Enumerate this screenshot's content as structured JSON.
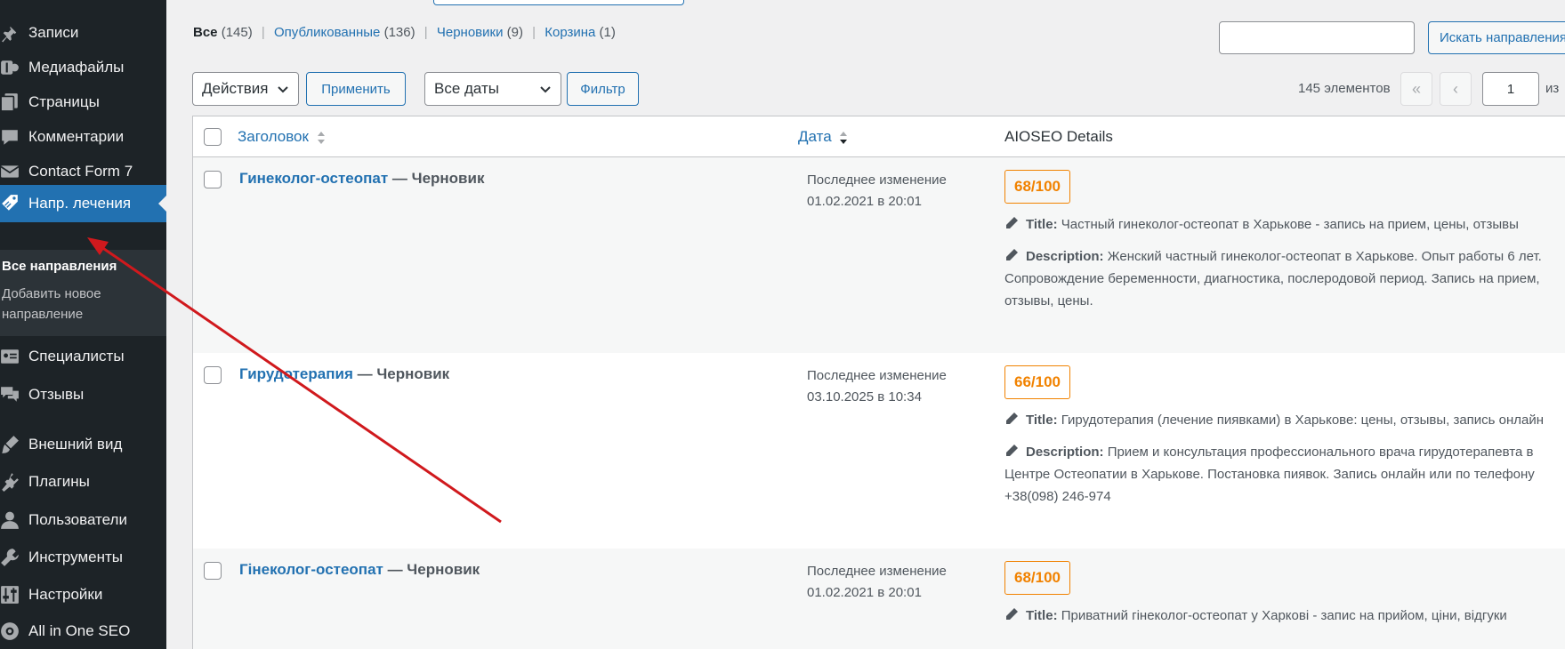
{
  "sidebar": {
    "items": [
      {
        "label": "Записи",
        "icon": "pin-icon"
      },
      {
        "label": "Медиафайлы",
        "icon": "media-icon"
      },
      {
        "label": "Страницы",
        "icon": "pages-icon"
      },
      {
        "label": "Комментарии",
        "icon": "comments-icon"
      },
      {
        "label": "Contact Form 7",
        "icon": "mail-icon"
      },
      {
        "label": "Напр. лечения",
        "icon": "tag-icon"
      },
      {
        "label": "Специалисты",
        "icon": "id-card-icon"
      },
      {
        "label": "Отзывы",
        "icon": "reviews-icon"
      },
      {
        "label": "Внешний вид",
        "icon": "brush-icon"
      },
      {
        "label": "Плагины",
        "icon": "plugin-icon"
      },
      {
        "label": "Пользователи",
        "icon": "user-icon"
      },
      {
        "label": "Инструменты",
        "icon": "wrench-icon"
      },
      {
        "label": "Настройки",
        "icon": "sliders-icon"
      },
      {
        "label": "All in One SEO",
        "icon": "aioseo-icon"
      }
    ],
    "submenu": {
      "all": "Все направления",
      "add_new": "Добавить новое направление"
    }
  },
  "filters": {
    "all": "Все",
    "all_count": "(145)",
    "published": "Опубликованные",
    "published_count": "(136)",
    "drafts": "Черновики",
    "drafts_count": "(9)",
    "trash": "Корзина",
    "trash_count": "(1)",
    "sep": "|"
  },
  "search": {
    "value": "",
    "button": "Искать направления"
  },
  "bulk": {
    "actions": "Действия",
    "apply": "Применить",
    "dates": "Все даты",
    "filter": "Фильтр"
  },
  "pagination": {
    "items": "145 элементов",
    "first": "«",
    "prev": "‹",
    "current": "1",
    "of": "из"
  },
  "table": {
    "columns": {
      "title": "Заголовок",
      "date": "Дата",
      "aioseo": "AIOSEO Details"
    },
    "rows": [
      {
        "title": "Гинеколог-остеопат",
        "state": " — Черновик",
        "date_label": "Последнее изменение",
        "date": "01.02.2021 в 20:01",
        "score": "68/100",
        "seo_title_label": "Title:",
        "seo_title": "Частный гинеколог-остеопат в Харькове - запись на прием, цены, отзывы",
        "seo_desc_label": "Description:",
        "seo_desc": "Женский частный гинеколог-остеопат в Харькове. Опыт работы 6 лет. Сопровождение беременности, диагностика, послеродовой период. Запись на прием, отзывы, цены."
      },
      {
        "title": "Гирудотерапия",
        "state": " — Черновик",
        "date_label": "Последнее изменение",
        "date": "03.10.2025 в 10:34",
        "score": "66/100",
        "seo_title_label": "Title:",
        "seo_title": "Гирудотерапия (лечение пиявками) в Харькове: цены, отзывы, запись онлайн",
        "seo_desc_label": "Description:",
        "seo_desc": "Прием и консультация профессионального врача гирудотерапевта в Центре Остеопатии в Харькове. Постановка пиявок. Запись онлайн или по телефону +38(098) 246-974"
      },
      {
        "title": "Гінеколог-остеопат",
        "state": " — Черновик",
        "date_label": "Последнее изменение",
        "date": "01.02.2021 в 20:01",
        "score": "68/100",
        "seo_title_label": "Title:",
        "seo_title": "Приватний гінеколог-остеопат у Харкові - запис на прийом, ціни, відгуки"
      }
    ]
  },
  "colors": {
    "sidebar": "#1d2327",
    "accent": "#2271b1",
    "score": "#f18200",
    "arrow": "#d0191d"
  }
}
